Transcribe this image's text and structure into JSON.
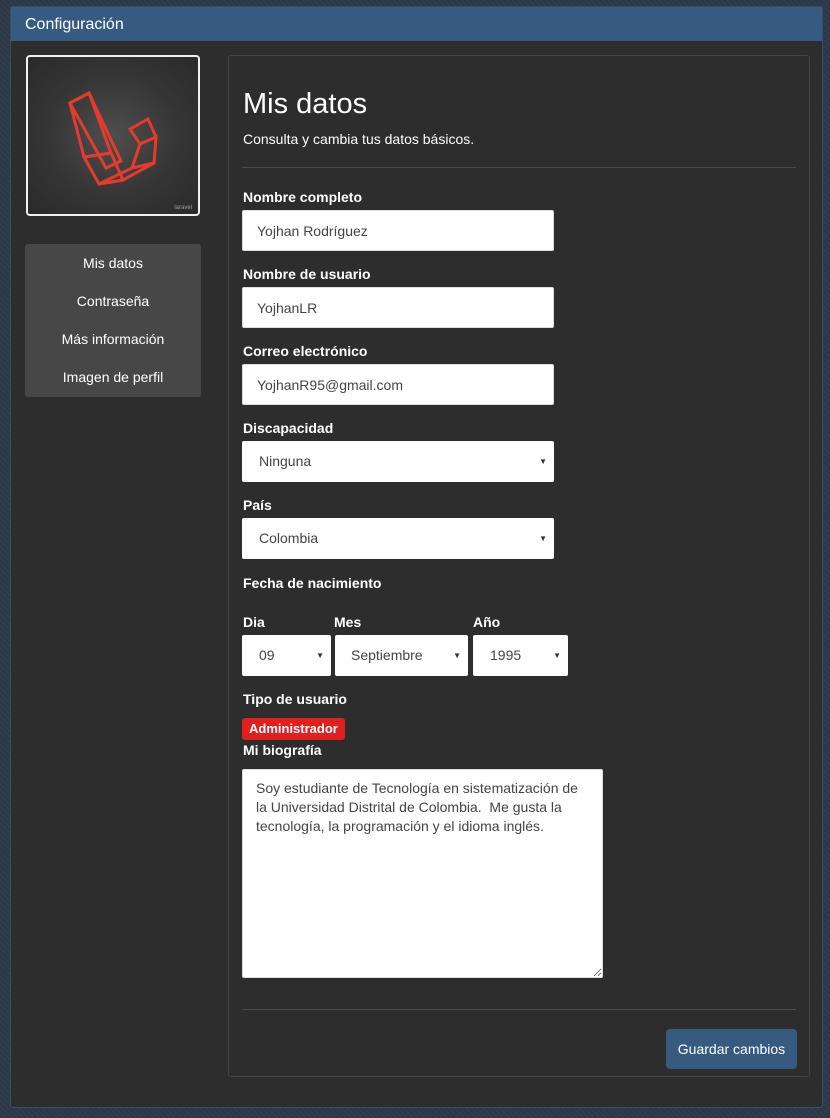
{
  "header": {
    "title": "Configuración"
  },
  "avatar": {
    "alt": "Imagen de perfil",
    "watermark": "laravel"
  },
  "sidebar": {
    "items": [
      {
        "label": "Mis datos"
      },
      {
        "label": "Contraseña"
      },
      {
        "label": "Más información"
      },
      {
        "label": "Imagen de perfil"
      }
    ]
  },
  "main": {
    "title": "Mis datos",
    "subtitle": "Consulta y cambia tus datos básicos.",
    "fields": {
      "full_name": {
        "label": "Nombre completo",
        "value": "Yojhan Rodríguez"
      },
      "username": {
        "label": "Nombre de usuario",
        "value": "YojhanLR"
      },
      "email": {
        "label": "Correo electrónico",
        "value": "YojhanR95@gmail.com"
      },
      "disability": {
        "label": "Discapacidad",
        "value": "Ninguna"
      },
      "country": {
        "label": "País",
        "value": "Colombia"
      }
    },
    "birthdate": {
      "label": "Fecha de nacimiento",
      "day": {
        "label": "Dia",
        "value": "09"
      },
      "month": {
        "label": "Mes",
        "value": "Septiembre"
      },
      "year": {
        "label": "Año",
        "value": "1995"
      }
    },
    "user_type": {
      "label": "Tipo de usuario",
      "badge": "Administrador"
    },
    "bio": {
      "label": "Mi biografía",
      "value": "Soy estudiante de Tecnología en sistematización de la Universidad Distrital de Colombia.  Me gusta la tecnología, la programación y el idioma inglés."
    },
    "save_label": "Guardar cambios"
  },
  "colors": {
    "accent": "#365a80",
    "badge": "#e01f1f",
    "panel_bg": "#2d2d2d",
    "logo_red": "#e53b2c"
  }
}
